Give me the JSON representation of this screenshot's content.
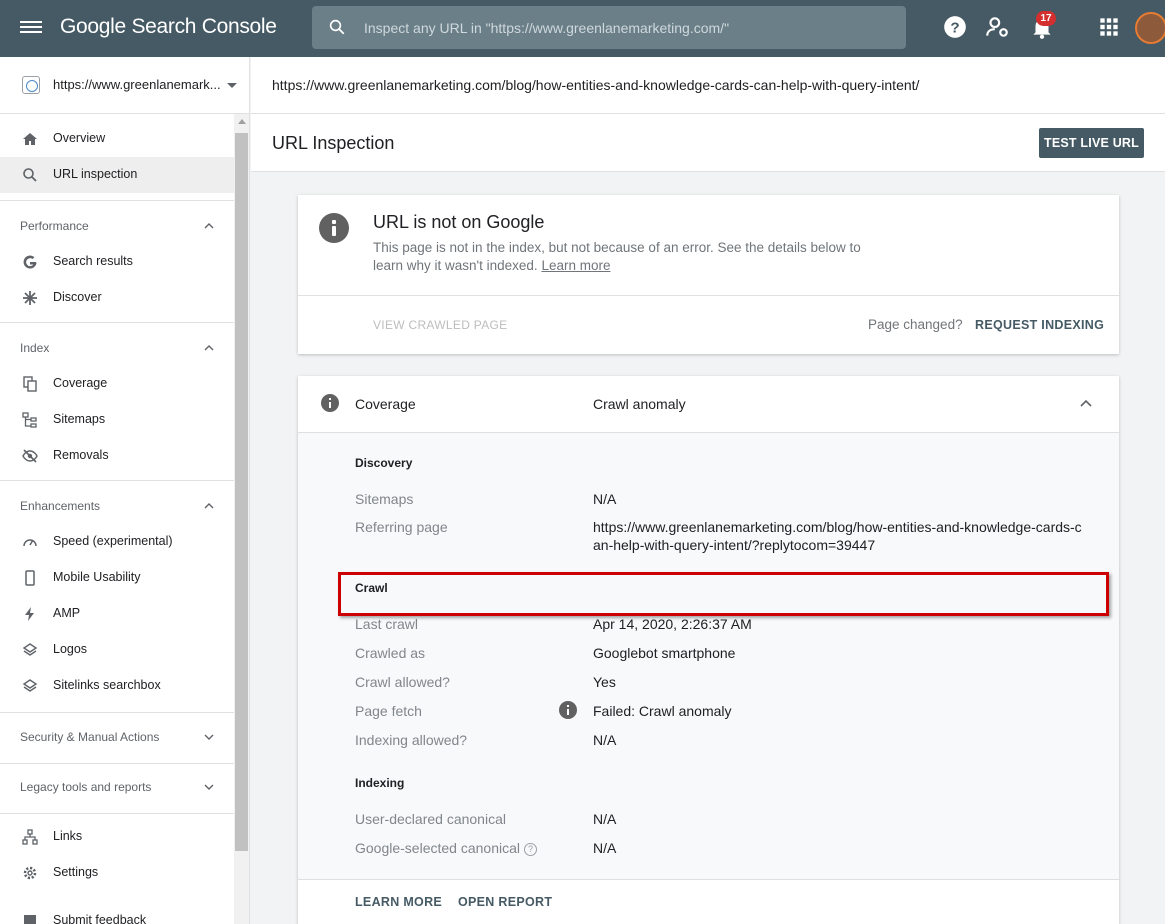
{
  "app": {
    "brand": "Google Search Console"
  },
  "search": {
    "placeholder": "Inspect any URL in \"https://www.greenlanemarketing.com/\""
  },
  "topbar": {
    "notification_count": "17"
  },
  "property": {
    "label": "https://www.greenlanemark..."
  },
  "sidebar": {
    "overview": "Overview",
    "url_inspection": "URL inspection",
    "performance": "Performance",
    "search_results": "Search results",
    "discover": "Discover",
    "index": "Index",
    "coverage": "Coverage",
    "sitemaps": "Sitemaps",
    "removals": "Removals",
    "enhancements": "Enhancements",
    "speed": "Speed (experimental)",
    "mobile_usability": "Mobile Usability",
    "amp": "AMP",
    "logos": "Logos",
    "sitelinks": "Sitelinks searchbox",
    "security": "Security & Manual Actions",
    "legacy": "Legacy tools and reports",
    "links": "Links",
    "settings": "Settings",
    "submit_feedback": "Submit feedback"
  },
  "inspected_url": "https://www.greenlanemarketing.com/blog/how-entities-and-knowledge-cards-can-help-with-query-intent/",
  "page": {
    "title": "URL Inspection",
    "test_live_label": "TEST LIVE URL"
  },
  "status": {
    "title": "URL is not on Google",
    "description": "This page is not in the index, but not because of an error. See the details below to learn why it wasn't indexed.",
    "learn_more": "Learn more",
    "view_crawled": "VIEW CRAWLED PAGE",
    "page_changed": "Page changed?",
    "request_indexing": "REQUEST INDEXING"
  },
  "coverage": {
    "label": "Coverage",
    "value": "Crawl anomaly",
    "discovery": {
      "heading": "Discovery",
      "sitemaps_label": "Sitemaps",
      "sitemaps_value": "N/A",
      "referring_label": "Referring page",
      "referring_value_line1": "https://www.greenlanemarketing.com/blog/how-entities-and-knowledge-cards-c",
      "referring_value_line2": "an-help-with-query-intent/?replytocom=39447"
    },
    "crawl": {
      "heading": "Crawl",
      "last_crawl_label": "Last crawl",
      "last_crawl_value": "Apr 14, 2020, 2:26:37 AM",
      "crawled_as_label": "Crawled as",
      "crawled_as_value": "Googlebot smartphone",
      "crawl_allowed_label": "Crawl allowed?",
      "crawl_allowed_value": "Yes",
      "page_fetch_label": "Page fetch",
      "page_fetch_value": "Failed: Crawl anomaly",
      "indexing_allowed_label": "Indexing allowed?",
      "indexing_allowed_value": "N/A"
    },
    "indexing": {
      "heading": "Indexing",
      "user_canonical_label": "User-declared canonical",
      "user_canonical_value": "N/A",
      "google_canonical_label": "Google-selected canonical",
      "google_canonical_value": "N/A"
    },
    "learn_more": "LEARN MORE",
    "open_report": "OPEN REPORT"
  }
}
